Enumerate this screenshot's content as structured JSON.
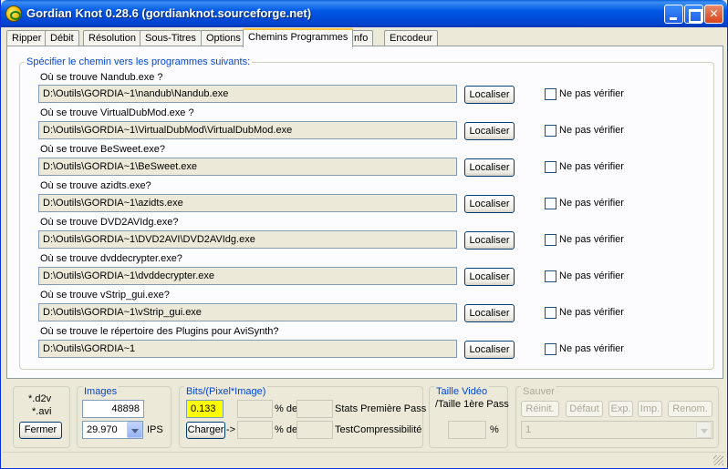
{
  "window": {
    "title": "Gordian Knot 0.28.6 (gordianknot.sourceforge.net)"
  },
  "tabs": [
    {
      "label": "Ripper"
    },
    {
      "label": "Débit"
    },
    {
      "label": "Résolution"
    },
    {
      "label": "Sous-Titres"
    },
    {
      "label": "Options"
    },
    {
      "label": "Chemins Programmes",
      "active": true
    },
    {
      "label": "Info"
    },
    {
      "label": "Encodeur"
    }
  ],
  "paths": {
    "group_title": "Spécifier le chemin vers les programmes suivants:",
    "locate_label": "Localiser",
    "skip_label": "Ne pas vérifier",
    "rows": [
      {
        "question": "Où se trouve Nandub.exe ?",
        "path": "D:\\Outils\\GORDIA~1\\nandub\\Nandub.exe"
      },
      {
        "question": "Où se trouve VirtualDubMod.exe ?",
        "path": "D:\\Outils\\GORDIA~1\\VirtualDubMod\\VirtualDubMod.exe"
      },
      {
        "question": "Où se trouve BeSweet.exe?",
        "path": "D:\\Outils\\GORDIA~1\\BeSweet.exe"
      },
      {
        "question": "Où se trouve azidts.exe?",
        "path": "D:\\Outils\\GORDIA~1\\azidts.exe"
      },
      {
        "question": "Où se trouve DVD2AVIdg.exe?",
        "path": "D:\\Outils\\GORDIA~1\\DVD2AVI\\DVD2AVIdg.exe"
      },
      {
        "question": "Où se trouve dvddecrypter.exe?",
        "path": "D:\\Outils\\GORDIA~1\\dvddecrypter.exe"
      },
      {
        "question": "Où se trouve vStrip_gui.exe?",
        "path": "D:\\Outils\\GORDIA~1\\vStrip_gui.exe"
      },
      {
        "question": "Où se trouve le répertoire des Plugins pour AviSynth?",
        "path": "D:\\Outils\\GORDIA~1"
      }
    ]
  },
  "bottom": {
    "files": {
      "d2v": "*.d2v",
      "avi": "*.avi",
      "close_label": "Fermer"
    },
    "images": {
      "title": "Images",
      "count": "48898",
      "fps": "29.970",
      "fps_unit": "IPS"
    },
    "bpp": {
      "title": "Bits/(Pixel*Image)",
      "value": "0.133",
      "pct_label": "% de",
      "stats_label": "Stats Première Pass",
      "load_label": "Charger",
      "arrow": "->",
      "pct_label2": "% de",
      "test_label": "TestCompressibilité"
    },
    "video_size": {
      "title": "Taille Vidéo",
      "subtitle": "/Taille 1ère Pass",
      "pct": "%"
    },
    "save": {
      "title": "Sauver",
      "buttons": [
        "Réinit.",
        "Défaut",
        "Exp.",
        "Imp.",
        "Renom."
      ],
      "selected": "1"
    }
  },
  "colors": {
    "accent": "#0046d5",
    "bpp_highlight": "#ffff00",
    "titlebar": "#0058e6"
  }
}
